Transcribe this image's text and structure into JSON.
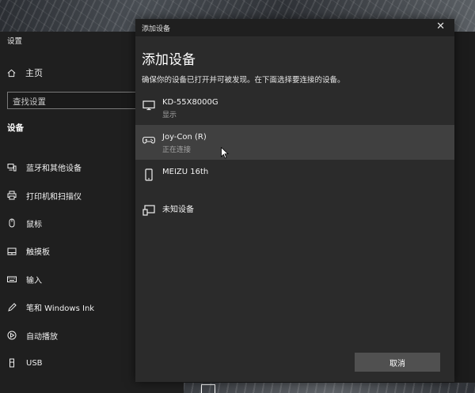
{
  "settings": {
    "window_title": "设置",
    "home_label": "主页",
    "search_placeholder": "查找设置",
    "section_heading": "设备",
    "nav_items": [
      {
        "label": "蓝牙和其他设备",
        "icon": "bluetooth-devices-icon"
      },
      {
        "label": "打印机和扫描仪",
        "icon": "printer-icon"
      },
      {
        "label": "鼠标",
        "icon": "mouse-icon"
      },
      {
        "label": "触摸板",
        "icon": "touchpad-icon"
      },
      {
        "label": "输入",
        "icon": "keyboard-icon"
      },
      {
        "label": "笔和 Windows Ink",
        "icon": "pen-icon"
      },
      {
        "label": "自动播放",
        "icon": "autoplay-icon"
      },
      {
        "label": "USB",
        "icon": "usb-icon"
      }
    ]
  },
  "dialog": {
    "title": "添加设备",
    "close_glyph": "✕",
    "heading": "添加设备",
    "description": "确保你的设备已打开并可被发现。在下面选择要连接的设备。",
    "devices": [
      {
        "name": "KD-55X8000G",
        "status": "显示",
        "icon": "monitor-icon",
        "selected": false
      },
      {
        "name": "Joy-Con (R)",
        "status": "正在连接",
        "icon": "gamepad-icon",
        "selected": true
      },
      {
        "name": "MEIZU 16th",
        "status": "",
        "icon": "phone-icon",
        "selected": false
      },
      {
        "name": "未知设备",
        "status": "",
        "icon": "unknown-device-icon",
        "selected": false
      }
    ],
    "cancel_label": "取消"
  }
}
